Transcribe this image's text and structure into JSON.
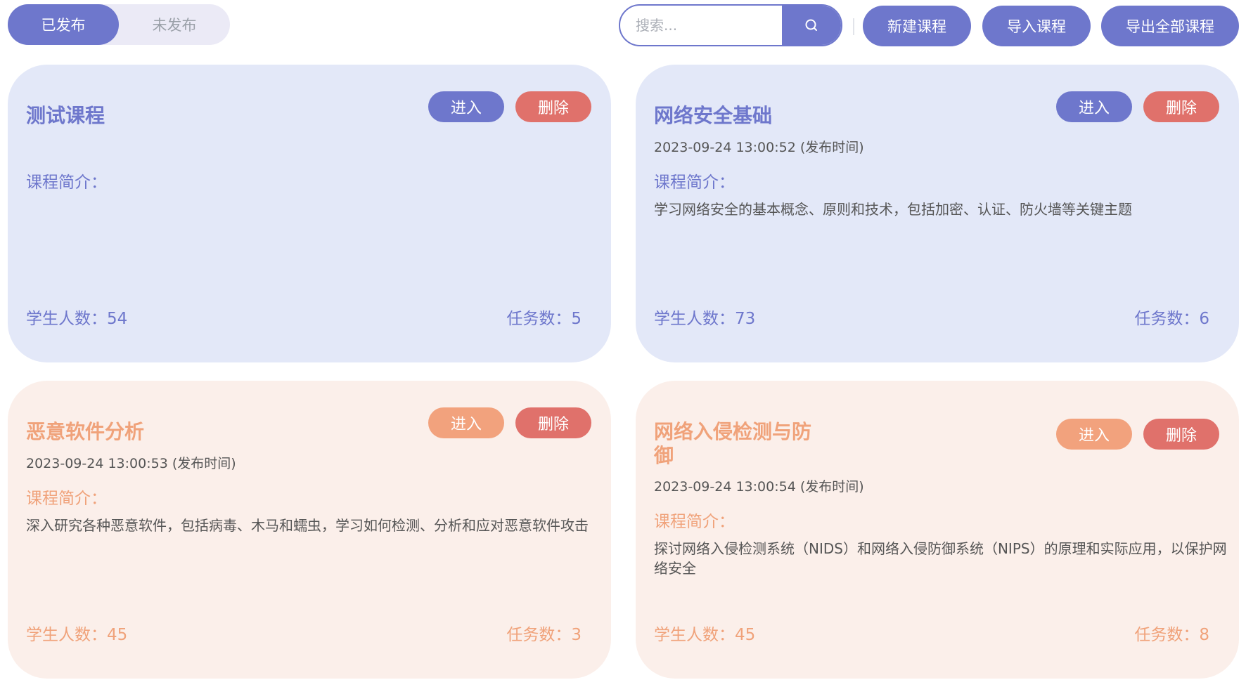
{
  "tabs": {
    "published": "已发布",
    "unpublished": "未发布"
  },
  "search": {
    "placeholder": "搜索..."
  },
  "toolbar": {
    "new_course": "新建课程",
    "import_course": "导入课程",
    "export_all": "导出全部课程"
  },
  "card_labels": {
    "enter": "进入",
    "delete": "删除",
    "intro_label": "课程简介："
  },
  "colors": {
    "accent": "#6e77cc",
    "peach": "#f0a27a",
    "danger": "#e0716b"
  },
  "courses": [
    {
      "title": "测试课程",
      "pub_time": "",
      "intro": "",
      "students": "学生人数：54",
      "tasks": "任务数：5"
    },
    {
      "title": "网络安全基础",
      "pub_time": "2023-09-24 13:00:52 (发布时间)",
      "intro": "学习网络安全的基本概念、原则和技术，包括加密、认证、防火墙等关键主题",
      "students": "学生人数：73",
      "tasks": "任务数：6"
    },
    {
      "title": "恶意软件分析",
      "pub_time": "2023-09-24 13:00:53 (发布时间)",
      "intro": "深入研究各种恶意软件，包括病毒、木马和蠕虫，学习如何检测、分析和应对恶意软件攻击",
      "students": "学生人数：45",
      "tasks": "任务数：3"
    },
    {
      "title": "网络入侵检测与防御",
      "pub_time": "2023-09-24 13:00:54 (发布时间)",
      "intro": "探讨网络入侵检测系统（NIDS）和网络入侵防御系统（NIPS）的原理和实际应用，以保护网络安全",
      "students": "学生人数：45",
      "tasks": "任务数：8"
    }
  ]
}
